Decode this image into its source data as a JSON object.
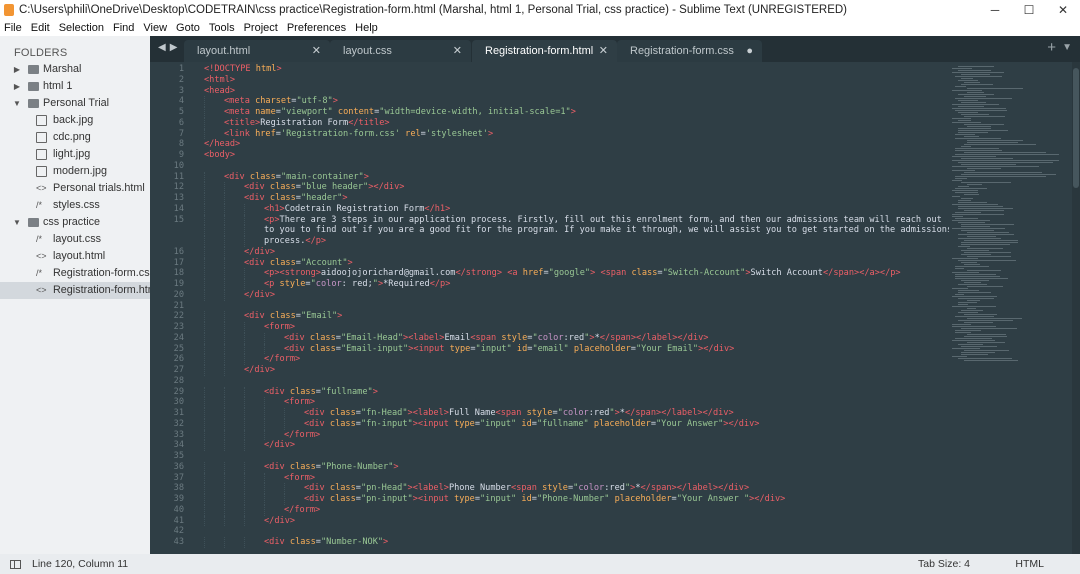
{
  "window": {
    "title": "C:\\Users\\phili\\OneDrive\\Desktop\\CODETRAIN\\css practice\\Registration-form.html (Marshal, html 1, Personal Trial, css practice) - Sublime Text (UNREGISTERED)",
    "minimize": "─",
    "maximize": "☐",
    "close": "✕"
  },
  "menu": [
    "File",
    "Edit",
    "Selection",
    "Find",
    "View",
    "Goto",
    "Tools",
    "Project",
    "Preferences",
    "Help"
  ],
  "sidebar": {
    "heading": "FOLDERS",
    "items": [
      {
        "label": "Marshal",
        "kind": "folder",
        "open": false,
        "depth": 0
      },
      {
        "label": "html 1",
        "kind": "folder",
        "open": false,
        "depth": 0
      },
      {
        "label": "Personal Trial",
        "kind": "folder",
        "open": true,
        "depth": 0
      },
      {
        "label": "back.jpg",
        "kind": "image",
        "depth": 1
      },
      {
        "label": "cdc.png",
        "kind": "image",
        "depth": 1
      },
      {
        "label": "light.jpg",
        "kind": "image",
        "depth": 1
      },
      {
        "label": "modern.jpg",
        "kind": "image",
        "depth": 1
      },
      {
        "label": "Personal trials.html",
        "kind": "html",
        "depth": 1
      },
      {
        "label": "styles.css",
        "kind": "css",
        "depth": 1
      },
      {
        "label": "css practice",
        "kind": "folder",
        "open": true,
        "depth": 0
      },
      {
        "label": "layout.css",
        "kind": "css",
        "depth": 1
      },
      {
        "label": "layout.html",
        "kind": "html",
        "depth": 1
      },
      {
        "label": "Registration-form.css",
        "kind": "css",
        "depth": 1
      },
      {
        "label": "Registration-form.html",
        "kind": "html",
        "depth": 1,
        "selected": true
      }
    ]
  },
  "tabs": [
    {
      "label": "layout.html",
      "active": false,
      "mark": "✕"
    },
    {
      "label": "layout.css",
      "active": false,
      "mark": "✕"
    },
    {
      "label": "Registration-form.html",
      "active": true,
      "mark": "✕"
    },
    {
      "label": "Registration-form.css",
      "active": false,
      "mark": "●"
    }
  ],
  "tab_controls": {
    "back": "◀",
    "forward": "▶",
    "add": "+",
    "dropdown": "▼"
  },
  "icons": {
    "arrow_closed": "▶",
    "arrow_open": "▼",
    "html": "<>",
    "css": "/*"
  },
  "editor": {
    "line_numbers": [
      "1",
      "2",
      "3",
      "4",
      "5",
      "6",
      "7",
      "8",
      "9",
      "10",
      "11",
      "12",
      "13",
      "14",
      "15",
      "",
      "",
      "16",
      "17",
      "18",
      "19",
      "20",
      "21",
      "22",
      "23",
      "24",
      "25",
      "26",
      "27",
      "28",
      "29",
      "30",
      "31",
      "32",
      "33",
      "34",
      "35",
      "36",
      "37",
      "38",
      "39",
      "40",
      "41",
      "42",
      "43"
    ],
    "lines": [
      {
        "indent": 0,
        "html": "<span class='tag'>&lt;!DOCTYPE</span> <span class='attr'>html</span><span class='tag'>&gt;</span>"
      },
      {
        "indent": 0,
        "html": "<span class='tag'>&lt;html&gt;</span>"
      },
      {
        "indent": 0,
        "html": "<span class='tag'>&lt;head&gt;</span>"
      },
      {
        "indent": 1,
        "html": "<span class='tag'>&lt;meta</span> <span class='attr'>charset</span>=<span class='str'>\"utf-8\"</span><span class='tag'>&gt;</span>"
      },
      {
        "indent": 1,
        "html": "<span class='tag'>&lt;meta</span> <span class='attr'>name</span>=<span class='str'>\"viewport\"</span> <span class='attr'>content</span>=<span class='str'>\"width=device-width, initial-scale=1\"</span><span class='tag'>&gt;</span>"
      },
      {
        "indent": 1,
        "html": "<span class='tag'>&lt;title&gt;</span>Registration Form<span class='tag'>&lt;/title&gt;</span>"
      },
      {
        "indent": 1,
        "html": "<span class='tag'>&lt;link</span> <span class='attr'>href</span>=<span class='str'>'Registration-form.css'</span> <span class='attr'>rel</span>=<span class='str'>'stylesheet'</span><span class='tag'>&gt;</span>"
      },
      {
        "indent": 0,
        "html": "<span class='tag'>&lt;/head&gt;</span>"
      },
      {
        "indent": 0,
        "html": "<span class='tag'>&lt;body&gt;</span>"
      },
      {
        "indent": 0,
        "html": ""
      },
      {
        "indent": 1,
        "html": "<span class='tag'>&lt;div</span> <span class='attr'>class</span>=<span class='str'>\"main-container\"</span><span class='tag'>&gt;</span>"
      },
      {
        "indent": 2,
        "html": "<span class='tag'>&lt;div</span> <span class='attr'>class</span>=<span class='str'>\"blue header\"</span><span class='tag'>&gt;&lt;/div&gt;</span>"
      },
      {
        "indent": 2,
        "html": "<span class='tag'>&lt;div</span> <span class='attr'>class</span>=<span class='str'>\"header\"</span><span class='tag'>&gt;</span>"
      },
      {
        "indent": 3,
        "html": "<span class='tag'>&lt;h1&gt;</span>Codetrain Registration Form<span class='tag'>&lt;/h1&gt;</span>"
      },
      {
        "indent": 3,
        "html": "<span class='tag'>&lt;p&gt;</span>There are 3 steps in our application process. Firstly, fill out this enrolment form, and then our admissions team will reach out"
      },
      {
        "indent": 3,
        "html": "to you to find out if you are a good fit for the program. If you make it through, we will assist you to get started on the admissions"
      },
      {
        "indent": 3,
        "html": "process.<span class='tag'>&lt;/p&gt;</span>"
      },
      {
        "indent": 2,
        "html": "<span class='tag'>&lt;/div&gt;</span>"
      },
      {
        "indent": 2,
        "html": "<span class='tag'>&lt;div</span> <span class='attr'>class</span>=<span class='str'>\"Account\"</span><span class='tag'>&gt;</span>"
      },
      {
        "indent": 3,
        "html": "<span class='tag'>&lt;p&gt;&lt;strong&gt;</span>aidoojojorichard@gmail.com<span class='tag'>&lt;/strong&gt;</span> <span class='tag'>&lt;a</span> <span class='attr'>href</span>=<span class='str'>\"google\"</span><span class='tag'>&gt;</span> <span class='tag'>&lt;span</span> <span class='attr'>class</span>=<span class='str'>\"Switch-Account\"</span><span class='tag'>&gt;</span>Switch Account<span class='tag'>&lt;/span&gt;&lt;/a&gt;&lt;/p&gt;</span>"
      },
      {
        "indent": 3,
        "html": "<span class='tag'>&lt;p</span> <span class='attr'>style</span>=<span class='str'>\"</span><span class='kw'>color</span>: <span class='txt'>red</span>;<span class='str'>\"</span><span class='tag'>&gt;</span>*Required<span class='tag'>&lt;/p&gt;</span>"
      },
      {
        "indent": 2,
        "html": "<span class='tag'>&lt;/div&gt;</span>"
      },
      {
        "indent": 0,
        "html": ""
      },
      {
        "indent": 2,
        "html": "<span class='tag'>&lt;div</span> <span class='attr'>class</span>=<span class='str'>\"Email\"</span><span class='tag'>&gt;</span>"
      },
      {
        "indent": 3,
        "html": "<span class='tag'>&lt;form&gt;</span>"
      },
      {
        "indent": 4,
        "html": "<span class='tag'>&lt;div</span> <span class='attr'>class</span>=<span class='str'>\"Email-Head\"</span><span class='tag'>&gt;&lt;label&gt;</span>Email<span class='tag'>&lt;span</span> <span class='attr'>style</span>=<span class='str'>\"</span><span class='kw'>color</span>:<span class='txt'>red</span><span class='str'>\"</span><span class='tag'>&gt;</span>*<span class='tag'>&lt;/span&gt;&lt;/label&gt;&lt;/div&gt;</span>"
      },
      {
        "indent": 4,
        "html": "<span class='tag'>&lt;div</span> <span class='attr'>class</span>=<span class='str'>\"Email-input\"</span><span class='tag'>&gt;&lt;input</span> <span class='attr'>type</span>=<span class='str'>\"input\"</span> <span class='attr'>id</span>=<span class='str'>\"email\"</span> <span class='attr'>placeholder</span>=<span class='str'>\"Your Email\"</span><span class='tag'>&gt;&lt;/div&gt;</span>"
      },
      {
        "indent": 3,
        "html": "<span class='tag'>&lt;/form&gt;</span>"
      },
      {
        "indent": 2,
        "html": "<span class='tag'>&lt;/div&gt;</span>"
      },
      {
        "indent": 0,
        "html": ""
      },
      {
        "indent": 3,
        "html": "<span class='tag'>&lt;div</span> <span class='attr'>class</span>=<span class='str'>\"fullname\"</span><span class='tag'>&gt;</span>"
      },
      {
        "indent": 4,
        "html": "<span class='tag'>&lt;form&gt;</span>"
      },
      {
        "indent": 5,
        "html": "<span class='tag'>&lt;div</span> <span class='attr'>class</span>=<span class='str'>\"fn-Head\"</span><span class='tag'>&gt;&lt;label&gt;</span>Full Name<span class='tag'>&lt;span</span> <span class='attr'>style</span>=<span class='str'>\"</span><span class='kw'>color</span>:<span class='txt'>red</span><span class='str'>\"</span><span class='tag'>&gt;</span>*<span class='tag'>&lt;/span&gt;&lt;/label&gt;&lt;/div&gt;</span>"
      },
      {
        "indent": 5,
        "html": "<span class='tag'>&lt;div</span> <span class='attr'>class</span>=<span class='str'>\"fn-input\"</span><span class='tag'>&gt;&lt;input</span> <span class='attr'>type</span>=<span class='str'>\"input\"</span> <span class='attr'>id</span>=<span class='str'>\"fullname\"</span> <span class='attr'>placeholder</span>=<span class='str'>\"Your Answer\"</span><span class='tag'>&gt;&lt;/div&gt;</span>"
      },
      {
        "indent": 4,
        "html": "<span class='tag'>&lt;/form&gt;</span>"
      },
      {
        "indent": 3,
        "html": "<span class='tag'>&lt;/div&gt;</span>"
      },
      {
        "indent": 0,
        "html": ""
      },
      {
        "indent": 3,
        "html": "<span class='tag'>&lt;div</span> <span class='attr'>class</span>=<span class='str'>\"Phone-Number\"</span><span class='tag'>&gt;</span>"
      },
      {
        "indent": 4,
        "html": "<span class='tag'>&lt;form&gt;</span>"
      },
      {
        "indent": 5,
        "html": "<span class='tag'>&lt;div</span> <span class='attr'>class</span>=<span class='str'>\"pn-Head\"</span><span class='tag'>&gt;&lt;label&gt;</span>Phone Number<span class='tag'>&lt;span</span> <span class='attr'>style</span>=<span class='str'>\"</span><span class='kw'>color</span>:<span class='txt'>red</span><span class='str'>\"</span><span class='tag'>&gt;</span>*<span class='tag'>&lt;/span&gt;&lt;/label&gt;&lt;/div&gt;</span>"
      },
      {
        "indent": 5,
        "html": "<span class='tag'>&lt;div</span> <span class='attr'>class</span>=<span class='str'>\"pn-input\"</span><span class='tag'>&gt;&lt;input</span> <span class='attr'>type</span>=<span class='str'>\"input\"</span> <span class='attr'>id</span>=<span class='str'>\"Phone-Number\"</span> <span class='attr'>placeholder</span>=<span class='str'>\"Your Answer \"</span><span class='tag'>&gt;&lt;/div&gt;</span>"
      },
      {
        "indent": 4,
        "html": "<span class='tag'>&lt;/form&gt;</span>"
      },
      {
        "indent": 3,
        "html": "<span class='tag'>&lt;/div&gt;</span>"
      },
      {
        "indent": 0,
        "html": ""
      },
      {
        "indent": 3,
        "html": "<span class='tag'>&lt;div</span> <span class='attr'>class</span>=<span class='str'>\"Number-NOK\"</span><span class='tag'>&gt;</span>"
      }
    ]
  },
  "statusbar": {
    "position": "Line 120, Column 11",
    "tab_size": "Tab Size: 4",
    "syntax": "HTML"
  },
  "colors": {
    "editor_bg": "#2f3e45",
    "tag": "#ec5f67",
    "attribute": "#f9ae58",
    "string": "#99c794",
    "keyword": "#c594c5",
    "line_number": "#6b7a80"
  }
}
